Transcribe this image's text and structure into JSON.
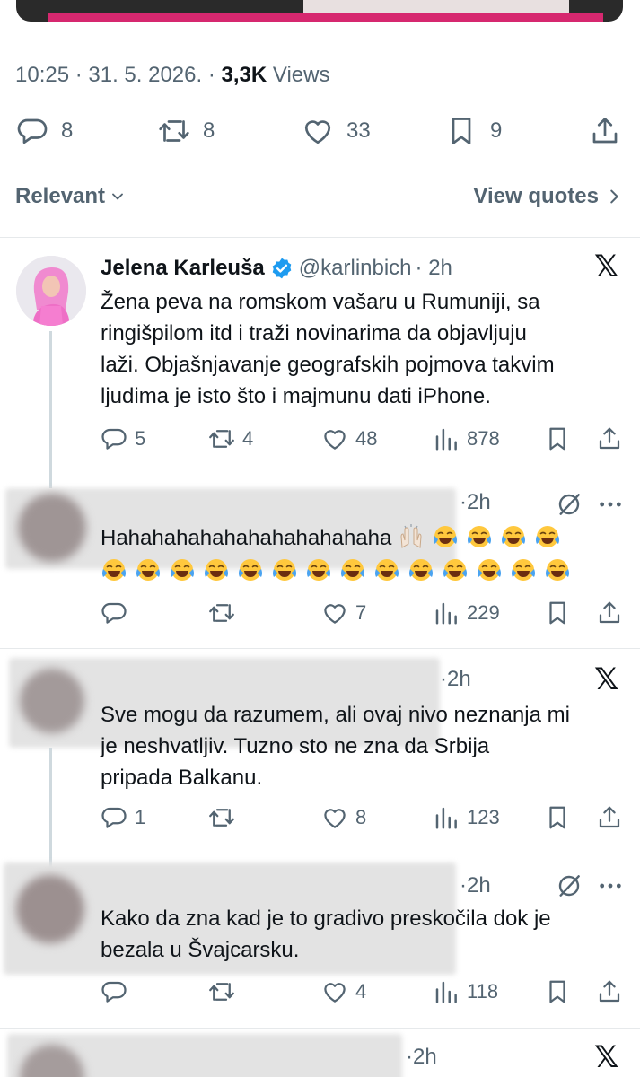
{
  "header": {
    "timestamp": "10:25 · 31. 5. 2026. · ",
    "views_count": "3,3K",
    "views_label": " Views"
  },
  "main_actions": {
    "replies": "8",
    "reposts": "8",
    "likes": "33",
    "bookmarks": "9"
  },
  "sort": {
    "label": "Relevant",
    "quotes_label": "View quotes"
  },
  "tweets": [
    {
      "name": "Jelena Karleuša",
      "handle": "@karlinbich",
      "time": "· 2h",
      "lines": [
        "Žena peva na romskom vašaru u Rumuniji, sa",
        "ringišpilom itd i traži novinarima da objavljuju",
        "laži. Objašnjavanje geografskih pojmova takvim",
        "ljudima je isto što i majmunu dati iPhone."
      ],
      "replies": "5",
      "reposts": "4",
      "likes": "48",
      "views": "878"
    },
    {
      "time": "·2h",
      "text": "Hahahahahahahahahahahaha",
      "replies": "",
      "reposts": "",
      "likes": "7",
      "views": "229"
    },
    {
      "time": "·2h",
      "lines": [
        "Sve mogu da razumem, ali ovaj nivo neznanja mi",
        "je neshvatljiv. Tuzno sto ne zna da Srbija",
        "pripada Balkanu."
      ],
      "replies": "1",
      "reposts": "",
      "likes": "8",
      "views": "123"
    },
    {
      "time": "·2h",
      "lines": [
        "Kako da zna kad je to gradivo preskočila dok je",
        "bezala u Švajcarsku."
      ],
      "replies": "",
      "reposts": "",
      "likes": "4",
      "views": "118"
    },
    {
      "time": "·2h"
    }
  ],
  "colors": {
    "text": "#0f1419",
    "muted": "#536471",
    "verified": "#1d9bf0",
    "separator": "#e6e9eb"
  },
  "icons": [
    "reply-icon",
    "repost-icon",
    "like-icon",
    "bookmark-icon",
    "share-icon",
    "views-icon",
    "x-logo-icon",
    "muted-icon",
    "more-icon",
    "chevron-down-icon",
    "chevron-right-icon",
    "verified-badge-icon"
  ]
}
